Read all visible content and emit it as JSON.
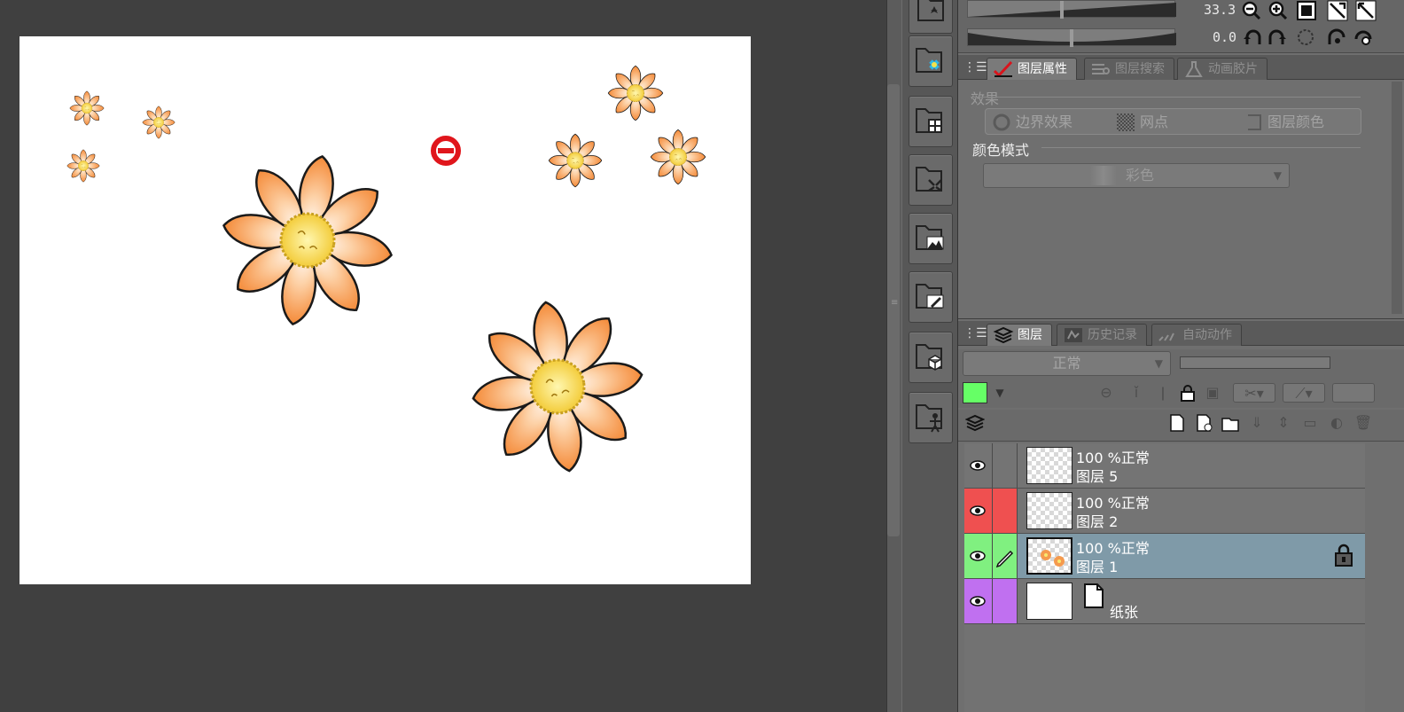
{
  "navigator": {
    "zoom_value": "33.3",
    "rotation_value": "0.0"
  },
  "property_tabs": [
    {
      "label": "图层属性",
      "active": true
    },
    {
      "label": "图层搜索",
      "active": false
    },
    {
      "label": "动画胶片",
      "active": false
    }
  ],
  "layer_property": {
    "effect_label": "效果",
    "effects": [
      "边界效果",
      "网点",
      "图层颜色"
    ],
    "color_mode_label": "颜色模式",
    "color_mode_value": "彩色"
  },
  "layer_tabs": [
    {
      "label": "图层",
      "active": true
    },
    {
      "label": "历史记录",
      "active": false
    },
    {
      "label": "自动动作",
      "active": false
    }
  ],
  "layer_panel": {
    "blend_mode": "正常",
    "layer_color": "#66ff66"
  },
  "layers": [
    {
      "opacity_mode": "100 %正常",
      "name": "图层 5",
      "color_tag": "",
      "selected": false,
      "locked": false,
      "editing": false
    },
    {
      "opacity_mode": "100 %正常",
      "name": "图层 2",
      "color_tag": "#ef5050",
      "selected": false,
      "locked": false,
      "editing": false
    },
    {
      "opacity_mode": "100 %正常",
      "name": "图层 1",
      "color_tag": "#80f080",
      "selected": true,
      "locked": true,
      "editing": true
    },
    {
      "opacity_mode": "",
      "name": "纸张",
      "color_tag": "#c070f0",
      "selected": false,
      "locked": false,
      "editing": false
    }
  ],
  "colors": {
    "petal_orange": "#f59a4e",
    "flower_center": "#f8e870",
    "canvas_bg": "#404040",
    "panel_bg": "#6f6f6f",
    "selected_layer": "#7f9aa8"
  },
  "icons": {
    "tab_menu": "tab-menu-icon",
    "forbidden_cursor": "forbidden-cursor-icon"
  }
}
